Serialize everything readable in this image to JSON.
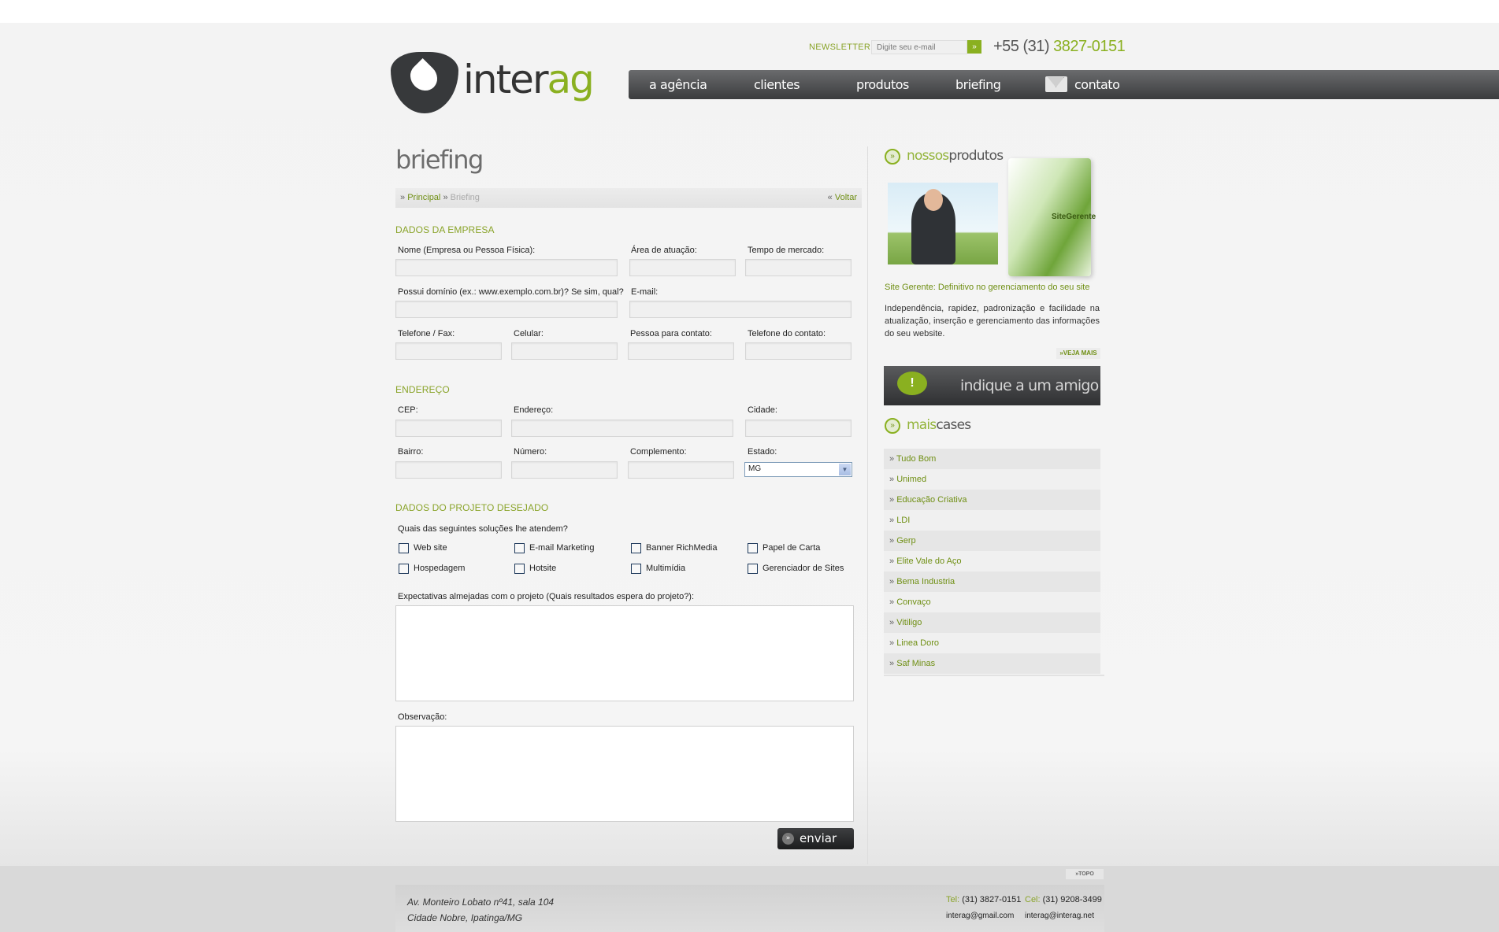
{
  "brand": {
    "name_dark": "inter",
    "name_green": "ag"
  },
  "header": {
    "newsletter_label": "NEWSLETTER:",
    "newsletter_placeholder": "Digite seu e-mail",
    "newsletter_button": "»",
    "phone_prefix": "+55 (31)",
    "phone_number": "3827-0151"
  },
  "nav": [
    {
      "label": "a agência"
    },
    {
      "label": "clientes"
    },
    {
      "label": "produtos"
    },
    {
      "label": "briefing"
    },
    {
      "label": "contato"
    }
  ],
  "page": {
    "title": "briefing",
    "breadcrumb": {
      "sep": "»",
      "home": "Principal",
      "current": "Briefing",
      "back_sep": "«",
      "back": "Voltar"
    }
  },
  "form": {
    "empresa_title": "DADOS DA EMPRESA",
    "labels": {
      "nome": "Nome (Empresa ou Pessoa Física):",
      "area": "Área de atuação:",
      "tempo": "Tempo de mercado:",
      "dominio": "Possui domínio (ex.: www.exemplo.com.br)? Se sim, qual?",
      "email": "E-mail:",
      "telefone": "Telefone / Fax:",
      "celular": "Celular:",
      "contato": "Pessoa para contato:",
      "tel_contato": "Telefone do contato:",
      "cep": "CEP:",
      "endereco": "Endereço:",
      "cidade": "Cidade:",
      "bairro": "Bairro:",
      "numero": "Número:",
      "complemento": "Complemento:",
      "estado": "Estado:"
    },
    "endereco_title": "ENDEREÇO",
    "estado_value": "MG",
    "projeto_title": "DADOS DO PROJETO DESEJADO",
    "solucoes_question": "Quais das seguintes soluções lhe atendem?",
    "solucoes": [
      "Web site",
      "E-mail Marketing",
      "Banner RichMedia",
      "Papel de Carta",
      "Hospedagem",
      "Hotsite",
      "Multimídia",
      "Gerenciador de Sites"
    ],
    "expectativas_label": "Expectativas almejadas com o projeto (Quais resultados espera do projeto?):",
    "observacao_label": "Observação:",
    "submit_label": "enviar"
  },
  "sidebar": {
    "produtos_light": "nossos",
    "produtos_dark": "produtos",
    "promo_box_label": "SiteGerente",
    "promo_title": "Site Gerente: Definitivo no gerenciamento do seu site",
    "promo_text": "Independência, rapidez, padronização e facilidade na atualização, inserção e gerenciamento das informações do seu website.",
    "veja_mais": "»veja mais",
    "indique": "indique a um amigo",
    "cases_light": "mais",
    "cases_dark": "cases",
    "cases": [
      "Tudo Bom",
      "Unimed",
      "Educação Criativa",
      "LDI",
      "Gerp",
      "Elite Vale do Aço",
      "Bema Industria",
      "Convaço",
      "Vitiligo",
      "Linea Doro",
      "Saf Minas"
    ]
  },
  "topo": "»topo",
  "footer": {
    "address_line1": "Av. Monteiro Lobato nº41, sala 104",
    "address_line2": "Cidade Nobre, Ipatinga/MG",
    "tel_label": "Tel:",
    "tel": "(31) 3827-0151",
    "cel_label": "Cel:",
    "cel": "(31) 9208-3499",
    "email1": "interag@gmail.com",
    "email2": "interag@interag.net"
  },
  "colors": {
    "accent_green": "#8ab020",
    "nav_dark": "#3b3c3e",
    "text_green": "#6f8f13"
  }
}
